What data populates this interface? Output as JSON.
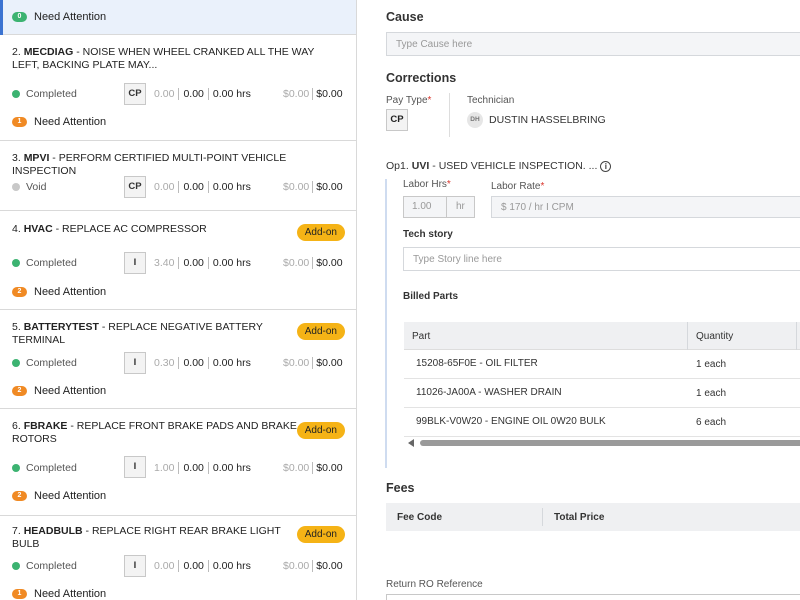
{
  "jobs_panel": {
    "top": {
      "attention_count": "0",
      "attention_label": "Need Attention"
    },
    "jobs": [
      {
        "num": "2.",
        "code": "MECDIAG",
        "desc": " - NOISE WHEN WHEEL CRANKED ALL THE WAY LEFT, BACKING PLATE MAY...",
        "addon": "",
        "status": "Completed",
        "status_color": "#3cb371",
        "pay_type": "CP",
        "hours_est": "0.00",
        "hours_act": "0.00",
        "hours_total": "0.00 hrs",
        "price_est": "$0.00",
        "price_total": "$0.00",
        "attention_count": "1",
        "attention_label": "Need Attention"
      },
      {
        "num": "3.",
        "code": "MPVI",
        "desc": " - PERFORM CERTIFIED MULTI-POINT VEHICLE INSPECTION",
        "addon": "",
        "status": "Void",
        "status_color": "#c8c8c8",
        "pay_type": "CP",
        "hours_est": "0.00",
        "hours_act": "0.00",
        "hours_total": "0.00 hrs",
        "price_est": "$0.00",
        "price_total": "$0.00",
        "attention_count": "",
        "attention_label": ""
      },
      {
        "num": "4.",
        "code": "HVAC",
        "desc": " - REPLACE AC COMPRESSOR",
        "addon": "Add-on",
        "status": "Completed",
        "status_color": "#3cb371",
        "pay_type": "I",
        "hours_est": "3.40",
        "hours_act": "0.00",
        "hours_total": "0.00 hrs",
        "price_est": "$0.00",
        "price_total": "$0.00",
        "attention_count": "2",
        "attention_label": "Need Attention"
      },
      {
        "num": "5.",
        "code": "BATTERYTEST",
        "desc": " - REPLACE NEGATIVE BATTERY TERMINAL",
        "addon": "Add-on",
        "status": "Completed",
        "status_color": "#3cb371",
        "pay_type": "I",
        "hours_est": "0.30",
        "hours_act": "0.00",
        "hours_total": "0.00 hrs",
        "price_est": "$0.00",
        "price_total": "$0.00",
        "attention_count": "2",
        "attention_label": "Need Attention"
      },
      {
        "num": "6.",
        "code": "FBRAKE",
        "desc": " - REPLACE FRONT BRAKE PADS AND BRAKE ROTORS",
        "addon": "Add-on",
        "status": "Completed",
        "status_color": "#3cb371",
        "pay_type": "I",
        "hours_est": "1.00",
        "hours_act": "0.00",
        "hours_total": "0.00 hrs",
        "price_est": "$0.00",
        "price_total": "$0.00",
        "attention_count": "2",
        "attention_label": "Need Attention"
      },
      {
        "num": "7.",
        "code": "HEADBULB",
        "desc": " - REPLACE RIGHT REAR BRAKE LIGHT BULB",
        "addon": "Add-on",
        "status": "Completed",
        "status_color": "#3cb371",
        "pay_type": "I",
        "hours_est": "0.00",
        "hours_act": "0.00",
        "hours_total": "0.00 hrs",
        "price_est": "$0.00",
        "price_total": "$0.00",
        "attention_count": "1",
        "attention_label": "Need Attention"
      }
    ]
  },
  "detail": {
    "cause_title": "Cause",
    "cause_placeholder": "Type Cause here",
    "corrections_title": "Corrections",
    "pay_type_label": "Pay Type",
    "required_mark": "*",
    "pay_type_value": "CP",
    "technician_label": "Technician",
    "tech_initials": "DH",
    "tech_name": "DUSTIN HASSELBRING",
    "op_prefix": "Op1. ",
    "op_code": "UVI",
    "op_desc": " - USED VEHICLE INSPECTION. ...",
    "info_glyph": "i",
    "labor_hrs_label": "Labor Hrs",
    "labor_hrs_value": "1.00",
    "labor_hrs_unit": "hr",
    "labor_rate_label": "Labor Rate",
    "labor_rate_value": "$ 170 / hr I CPM",
    "tech_story_label": "Tech story",
    "tech_story_placeholder": "Type Story line here",
    "billed_parts_label": "Billed Parts",
    "parts_headers": {
      "part": "Part",
      "quantity": "Quantity"
    },
    "parts": [
      {
        "part": "15208-65F0E - OIL FILTER",
        "quantity": "1 each"
      },
      {
        "part": "11026-JA00A - WASHER DRAIN",
        "quantity": "1 each"
      },
      {
        "part": "99BLK-V0W20 - ENGINE OIL 0W20 BULK",
        "quantity": "6 each"
      }
    ],
    "fees_title": "Fees",
    "fees_headers": {
      "code": "Fee Code",
      "total": "Total Price"
    },
    "return_ro_label": "Return RO Reference"
  }
}
